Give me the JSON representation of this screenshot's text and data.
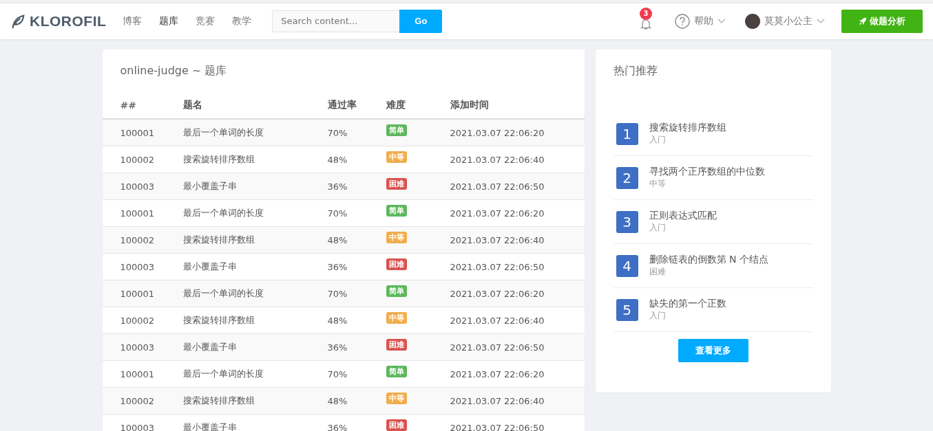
{
  "header": {
    "logo": "KLOROFIL",
    "nav": [
      {
        "label": "博客",
        "selected": false
      },
      {
        "label": "题库",
        "selected": true
      },
      {
        "label": "竞赛",
        "selected": false
      },
      {
        "label": "教学",
        "selected": false
      }
    ],
    "search": {
      "placeholder": "Search content...",
      "button": "Go"
    },
    "notifications": {
      "count": "3"
    },
    "help": "帮助",
    "user": "莫莫小公主",
    "action": "做题分析"
  },
  "problems": {
    "title": "online-judge ~ 题库",
    "columns": [
      "##",
      "题名",
      "通过率",
      "难度",
      "添加时间"
    ],
    "rows": [
      {
        "id": "100001",
        "name": "最后一个单词的长度",
        "rate": "70%",
        "difficulty": {
          "label": "简单",
          "kind": "easy"
        },
        "time": "2021.03.07 22:06:20"
      },
      {
        "id": "100002",
        "name": "搜索旋转排序数组",
        "rate": "48%",
        "difficulty": {
          "label": "中等",
          "kind": "medium"
        },
        "time": "2021.03.07 22:06:40"
      },
      {
        "id": "100003",
        "name": "最小覆盖子串",
        "rate": "36%",
        "difficulty": {
          "label": "困难",
          "kind": "hard"
        },
        "time": "2021.03.07 22:06:50"
      },
      {
        "id": "100001",
        "name": "最后一个单词的长度",
        "rate": "70%",
        "difficulty": {
          "label": "简单",
          "kind": "easy"
        },
        "time": "2021.03.07 22:06:20"
      },
      {
        "id": "100002",
        "name": "搜索旋转排序数组",
        "rate": "48%",
        "difficulty": {
          "label": "中等",
          "kind": "medium"
        },
        "time": "2021.03.07 22:06:40"
      },
      {
        "id": "100003",
        "name": "最小覆盖子串",
        "rate": "36%",
        "difficulty": {
          "label": "困难",
          "kind": "hard"
        },
        "time": "2021.03.07 22:06:50"
      },
      {
        "id": "100001",
        "name": "最后一个单词的长度",
        "rate": "70%",
        "difficulty": {
          "label": "简单",
          "kind": "easy"
        },
        "time": "2021.03.07 22:06:20"
      },
      {
        "id": "100002",
        "name": "搜索旋转排序数组",
        "rate": "48%",
        "difficulty": {
          "label": "中等",
          "kind": "medium"
        },
        "time": "2021.03.07 22:06:40"
      },
      {
        "id": "100003",
        "name": "最小覆盖子串",
        "rate": "36%",
        "difficulty": {
          "label": "困难",
          "kind": "hard"
        },
        "time": "2021.03.07 22:06:50"
      },
      {
        "id": "100001",
        "name": "最后一个单词的长度",
        "rate": "70%",
        "difficulty": {
          "label": "简单",
          "kind": "easy"
        },
        "time": "2021.03.07 22:06:20"
      },
      {
        "id": "100002",
        "name": "搜索旋转排序数组",
        "rate": "48%",
        "difficulty": {
          "label": "中等",
          "kind": "medium"
        },
        "time": "2021.03.07 22:06:40"
      },
      {
        "id": "100003",
        "name": "最小覆盖子串",
        "rate": "36%",
        "difficulty": {
          "label": "困难",
          "kind": "hard"
        },
        "time": "2021.03.07 22:06:50"
      }
    ]
  },
  "hot": {
    "title": "热门推荐",
    "items": [
      {
        "rank": "1",
        "name": "搜索旋转排序数组",
        "level_text": "入门"
      },
      {
        "rank": "2",
        "name": "寻找两个正序数组的中位数",
        "level_text": "中等"
      },
      {
        "rank": "3",
        "name": "正则表达式匹配",
        "level_text": "入门"
      },
      {
        "rank": "4",
        "name": "删除链表的倒数第 N 个结点",
        "level_text": "困难"
      },
      {
        "rank": "5",
        "name": "缺失的第一个正数",
        "level_text": "入门"
      }
    ],
    "more": "查看更多"
  }
}
